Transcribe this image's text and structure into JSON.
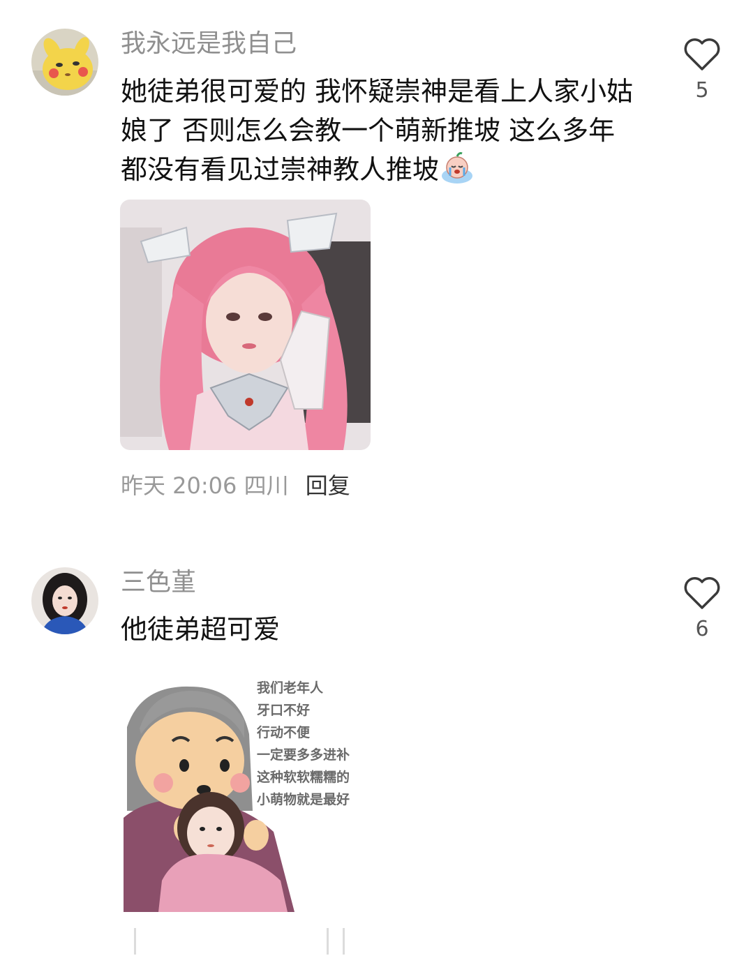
{
  "comments": [
    {
      "username": "我永远是我自己",
      "avatar_icon": "pikachu-plush-avatar",
      "text": "她徒弟很可爱的 我怀疑崇神是看上人家小姑娘了 否则怎么会教一个萌新推坡 这么多年都没有看见过崇神教人推坡",
      "inline_emoji": "crying-face-emoji",
      "image_icon": "pink-hair-cosplay-photo",
      "likes": "5",
      "time": "昨天 20:06",
      "location": "四川",
      "reply_label": "回复"
    },
    {
      "username": "三色堇",
      "avatar_icon": "girl-portrait-avatar",
      "text": "他徒弟超可爱",
      "image_icon": "grandma-holding-girl-sticker",
      "sticker_caption": [
        "我们老年人",
        "牙口不好",
        "行动不便",
        "一定要多多进补",
        "这种软软糯糯的",
        "小萌物就是最好"
      ],
      "likes": "6"
    }
  ],
  "colors": {
    "username": "#8f8f8f",
    "meta": "#999999",
    "text": "#111111"
  }
}
